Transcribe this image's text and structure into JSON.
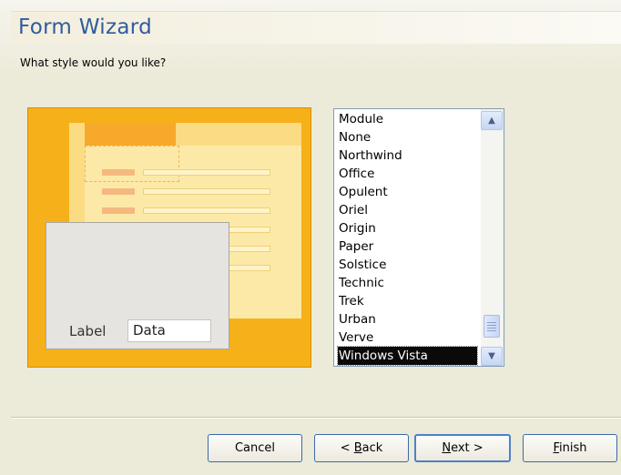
{
  "window": {
    "title": "Form Wizard"
  },
  "prompt": {
    "question": "What style would you like?"
  },
  "preview": {
    "label_text": "Label",
    "data_text": "Data"
  },
  "style_list": {
    "items": [
      "Module",
      "None",
      "Northwind",
      "Office",
      "Opulent",
      "Oriel",
      "Origin",
      "Paper",
      "Solstice",
      "Technic",
      "Trek",
      "Urban",
      "Verve",
      "Windows Vista"
    ],
    "selected": "Windows Vista"
  },
  "buttons": {
    "cancel": "Cancel",
    "back_prefix": "< ",
    "back_key": "B",
    "back_rest": "ack",
    "next_key": "N",
    "next_rest": "ext >",
    "finish_key": "F",
    "finish_rest": "inish"
  },
  "icons": {
    "scroll_up": "chevron-up-icon",
    "scroll_down": "chevron-down-icon"
  },
  "colors": {
    "title": "#2f5d9c",
    "preview_accent": "#f6b01a",
    "selection": "#0a0a0a"
  }
}
